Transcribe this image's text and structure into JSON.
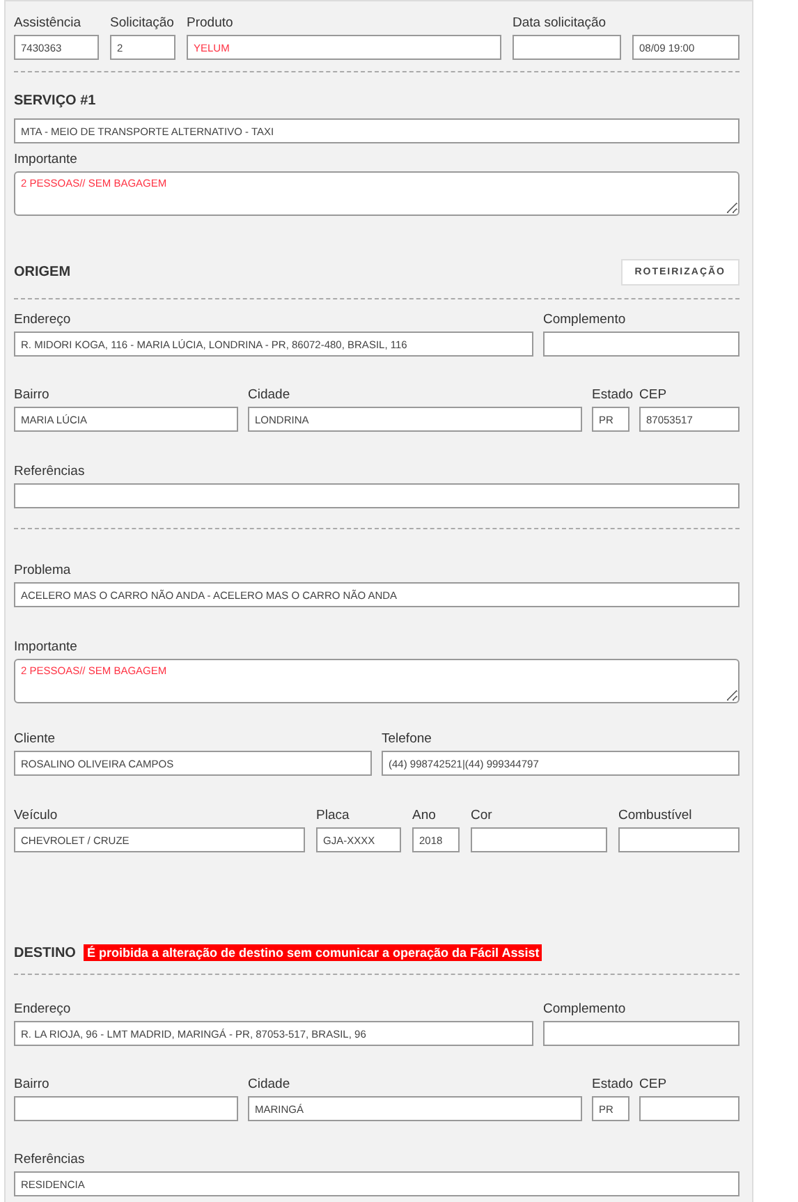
{
  "blocks": [
    {
      "kind": "ids",
      "fields": [
        {
          "label": "Assistência",
          "value": "7430363",
          "kind": "input",
          "highlight": false
        },
        {
          "label": "Solicitação",
          "value": "2",
          "kind": "input",
          "highlight": false
        },
        {
          "label": "Produto",
          "value": "YELUM",
          "kind": "input",
          "highlight": true
        },
        {
          "label": "Data solicitação",
          "kind": "input"
        },
        {
          "value": "08/09 19:00",
          "kind": "input",
          "highlight": false
        }
      ]
    },
    {
      "kind": "divider"
    },
    {
      "kind": "heading",
      "title": "SERVIÇO #1"
    },
    {
      "kind": "single",
      "fields": [
        {
          "value": "MTA - MEIO DE TRANSPORTE ALTERNATIVO - TAXI",
          "kind": "input",
          "highlight": false
        }
      ]
    },
    {
      "kind": "single",
      "fields": [
        {
          "label": "Importante",
          "value": "2 PESSOAS// SEM BAGAGEM",
          "kind": "textarea",
          "highlight": true
        }
      ]
    },
    {
      "kind": "heading",
      "title": "ORIGEM",
      "button": "ROTEIRIZAÇÃO"
    },
    {
      "kind": "divider"
    },
    {
      "kind": "address",
      "fields": [
        {
          "label": "Endereço",
          "value": "R. MIDORI KOGA, 116 - MARIA LÚCIA, LONDRINA - PR, 86072-480, BRASIL, 116",
          "kind": "input",
          "highlight": false
        },
        {
          "label": "Complemento",
          "kind": "input"
        }
      ]
    },
    {
      "kind": "locality",
      "fields": [
        {
          "label": "Bairro",
          "value": "MARIA LÚCIA",
          "kind": "input",
          "highlight": false
        },
        {
          "label": "Cidade",
          "value": "LONDRINA",
          "kind": "input",
          "highlight": false
        },
        {
          "label": "Estado",
          "value": "PR",
          "kind": "input",
          "highlight": false
        },
        {
          "label": "CEP",
          "value": "87053517",
          "kind": "input",
          "highlight": false
        }
      ]
    },
    {
      "kind": "single",
      "fields": [
        {
          "label": "Referências",
          "kind": "input"
        }
      ]
    },
    {
      "kind": "divider"
    },
    {
      "kind": "single",
      "fields": [
        {
          "label": "Problema",
          "value": "ACELERO MAS O CARRO NÃO ANDA - ACELERO MAS O CARRO NÃO ANDA",
          "kind": "input",
          "highlight": false
        }
      ]
    },
    {
      "kind": "single",
      "fields": [
        {
          "label": "Importante",
          "value": "2 PESSOAS// SEM BAGAGEM",
          "kind": "textarea",
          "highlight": true
        }
      ]
    },
    {
      "kind": "contact",
      "fields": [
        {
          "label": "Cliente",
          "value": "ROSALINO OLIVEIRA CAMPOS",
          "kind": "input",
          "highlight": false
        },
        {
          "label": "Telefone",
          "value": "(44) 998742521|(44) 999344797",
          "kind": "input",
          "highlight": false
        }
      ]
    },
    {
      "kind": "vehicle",
      "fields": [
        {
          "label": "Veículo",
          "value": "CHEVROLET / CRUZE",
          "kind": "input",
          "highlight": false
        },
        {
          "label": "Placa",
          "value": "GJA-XXXX",
          "kind": "input",
          "highlight": false
        },
        {
          "label": "Ano",
          "value": "2018",
          "kind": "input",
          "highlight": false
        },
        {
          "label": "Cor",
          "kind": "input"
        },
        {
          "label": "Combustível",
          "kind": "input"
        }
      ]
    },
    {
      "kind": "heading",
      "title": "DESTINO",
      "notice": "É proibida a alteração de destino sem comunicar a operação da Fácil Assist"
    },
    {
      "kind": "divider"
    },
    {
      "kind": "address",
      "fields": [
        {
          "label": "Endereço",
          "value": "R. LA RIOJA, 96 - LMT MADRID, MARINGÁ - PR, 87053-517, BRASIL, 96",
          "kind": "input",
          "highlight": false
        },
        {
          "label": "Complemento",
          "kind": "input"
        }
      ]
    },
    {
      "kind": "locality",
      "fields": [
        {
          "label": "Bairro",
          "kind": "input"
        },
        {
          "label": "Cidade",
          "value": "MARINGÁ",
          "kind": "input",
          "highlight": false
        },
        {
          "label": "Estado",
          "value": "PR",
          "kind": "input",
          "highlight": false
        },
        {
          "label": "CEP",
          "kind": "input"
        }
      ]
    },
    {
      "kind": "single",
      "fields": [
        {
          "label": "Referências",
          "value": "RESIDENCIA",
          "kind": "input",
          "highlight": false
        }
      ]
    }
  ]
}
